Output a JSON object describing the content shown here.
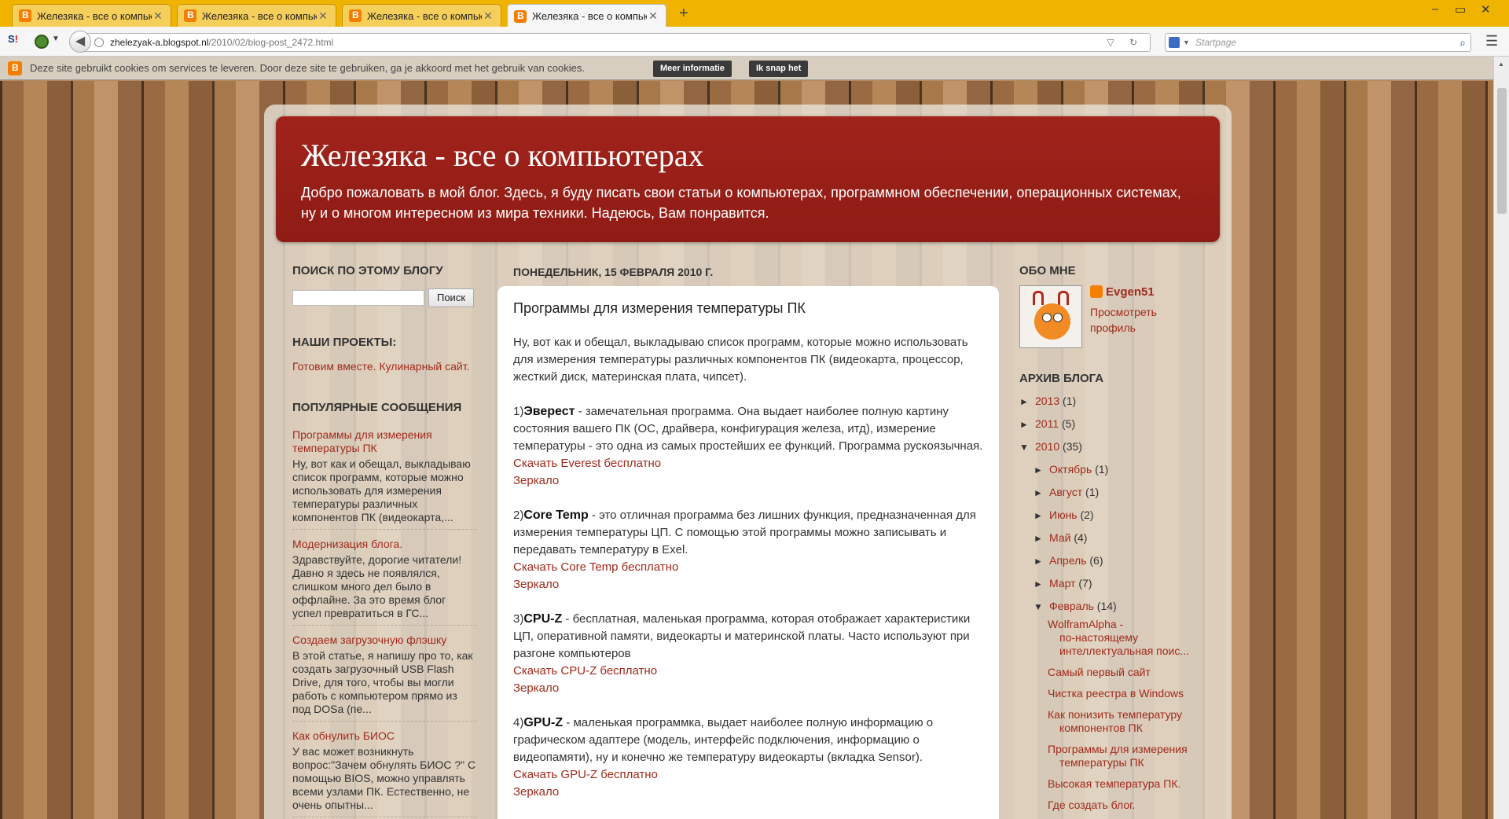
{
  "browser": {
    "tabs": [
      {
        "title": "Железяка - все о компью..."
      },
      {
        "title": "Железяка - все о компью..."
      },
      {
        "title": "Железяка - все о компью..."
      },
      {
        "title": "Железяка - все о компью..."
      }
    ],
    "new_tab": "+",
    "url_host": "zhelezyak-a.blogspot.nl",
    "url_path": "/2010/02/blog-post_2472.html",
    "search_placeholder": "Startpage",
    "window_controls": [
      "–",
      "▭",
      "✕"
    ]
  },
  "cookie": {
    "text": "Deze site gebruikt cookies om services te leveren. Door deze site te gebruiken, ga je akkoord met het gebruik van cookies.",
    "more_label": "Meer informatie",
    "ok_label": "Ik snap het"
  },
  "blog": {
    "title": "Железяка - все о компьютерах",
    "description": "Добро пожаловать в мой блог. Здесь, я буду писать свои статьи о компьютерах, программном обеспечении, операционных системах, ну и о многом интересном из мира техники. Надеюсь, Вам понравится."
  },
  "left": {
    "search_heading": "ПОИСК ПО ЭТОМУ БЛОГУ",
    "search_button": "Поиск",
    "projects_heading": "НАШИ ПРОЕКТЫ:",
    "projects_link": "Готовим вместе. Кулинарный сайт.",
    "popular_heading": "ПОПУЛЯРНЫЕ СООБЩЕНИЯ",
    "popular": [
      {
        "title": "Программы для измерения температуры ПК",
        "snippet": "Ну, вот как и обещал, выкладываю список программ, которые можно использовать для измерения температуры различных компонентов ПК (видеокарта,..."
      },
      {
        "title": "Модернизация блога.",
        "snippet": "Здравствуйте, дорогие читатели! Давно я здесь не появлялся, слишком много дел было в оффлайне. За это время блог успел превратиться в ГС..."
      },
      {
        "title": "Создаем загрузочную флэшку",
        "snippet": "В этой статье, я напишу про то, как создать загрузочный USB Flash Drive, для того, чтобы вы могли работь с компьютером прямо из под DOSa (пе..."
      },
      {
        "title": "Как обнулить БИОС",
        "snippet": "У вас может возникнуть вопрос:\"Зачем обнулять БИОС ?\" С помощью BIOS, можно управлять всеми узлами ПК. Естественно, не очень опытны..."
      }
    ]
  },
  "post": {
    "date": "ПОНЕДЕЛЬНИК, 15 ФЕВРАЛЯ 2010 Г.",
    "title": "Программы для измерения температуры ПК",
    "intro": "Ну, вот как и обещал, выкладываю список программ, которые можно использовать для измерения температуры различных компонентов ПК (видеокарта, процессор, жесткий диск, материнская плата, чипсет).",
    "items": [
      {
        "num": "1)",
        "name": "Эверест",
        "text": " - замечательная программа. Она выдает наиболее полную картину состояния вашего ПК (ОС, драйвера, конфигурация железа, итд), измерение температуры - это одна из самых простейших ее функций. Программа рускоязычная.",
        "download": "Скачать Everest бесплатно",
        "mirror": "Зеркало"
      },
      {
        "num": "2)",
        "name": "Core Temp",
        "text": " - это отличная программа без лишних функция, предназначенная для измерения температуры ЦП. С помощью этой программы можно записывать и передавать температуру в Exel.",
        "download": "Скачать Core Temp бесплатно",
        "mirror": "Зеркало"
      },
      {
        "num": "3)",
        "name": "CPU-Z",
        "text": " - бесплатная, маленькая программа, которая отображает характеристики ЦП, оперативной памяти, видеокарты и материнской платы. Часто используют при разгоне компьютеров",
        "download": "Скачать CPU-Z бесплатно",
        "mirror": "Зеркало"
      },
      {
        "num": "4)",
        "name": "GPU-Z",
        "text": " - маленькая программка, выдает наиболее полную информацию о графическом адаптере (модель, интерфейс подключения, информацию о видеопамяти), ну и конечно же температуру видеокарты (вкладка Sensor).",
        "download": "Скачать GPU-Z бесплатно",
        "mirror": "Зеркало"
      }
    ]
  },
  "right": {
    "about_heading": "ОБО МНЕ",
    "profile_name": "Evgen51",
    "profile_link": "Просмотреть профиль",
    "archive_heading": "АРХИВ БЛОГА",
    "years": [
      {
        "tri": "►",
        "year": "2013",
        "count": "(1)"
      },
      {
        "tri": "►",
        "year": "2011",
        "count": "(5)"
      },
      {
        "tri": "▼",
        "year": "2010",
        "count": "(35)"
      }
    ],
    "months": [
      {
        "tri": "►",
        "month": "Октябрь",
        "count": "(1)"
      },
      {
        "tri": "►",
        "month": "Август",
        "count": "(1)"
      },
      {
        "tri": "►",
        "month": "Июнь",
        "count": "(2)"
      },
      {
        "tri": "►",
        "month": "Май",
        "count": "(4)"
      },
      {
        "tri": "►",
        "month": "Апрель",
        "count": "(6)"
      },
      {
        "tri": "►",
        "month": "Март",
        "count": "(7)"
      },
      {
        "tri": "▼",
        "month": "Февраль",
        "count": "(14)"
      }
    ],
    "posts": [
      {
        "l1": "WolframAlpha -",
        "l2": "по-настоящему",
        "l3": "интеллектуальная поис..."
      },
      {
        "l1": "Самый первый сайт"
      },
      {
        "l1": "Чистка реестра в Windows"
      },
      {
        "l1": "Как понизить температуру",
        "l2": "компонентов ПК"
      },
      {
        "l1": "Программы для измерения",
        "l2": "температуры ПК"
      },
      {
        "l1": "Высокая температура ПК."
      },
      {
        "l1": "Где создать блог."
      }
    ]
  }
}
